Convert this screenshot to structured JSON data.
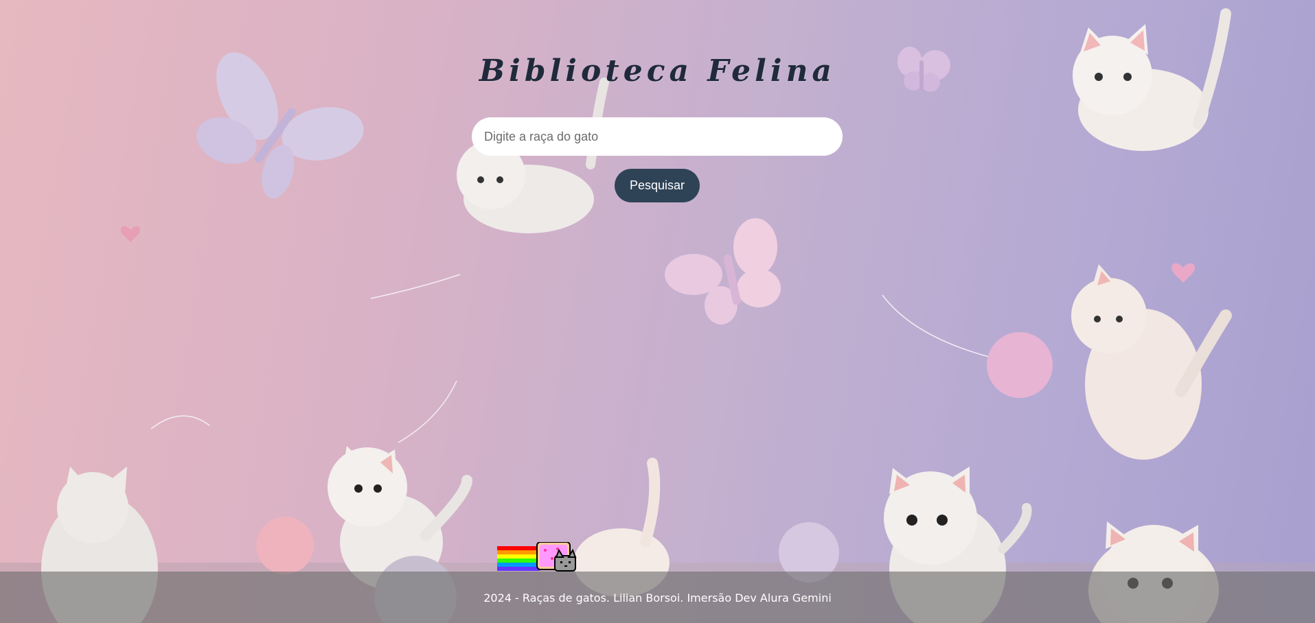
{
  "header": {
    "title": "Biblioteca Felina"
  },
  "search": {
    "placeholder": "Digite a raça do gato",
    "value": "",
    "button_label": "Pesquisar"
  },
  "footer": {
    "text": "2024 - Raças de gatos. Lilian Borsoi. Imersão Dev Alura Gemini"
  },
  "colors": {
    "title": "#1f2a3a",
    "button": "#2f4357",
    "footer_overlay": "#6e6e6e"
  },
  "icons": {
    "footer_gif": "nyan-cat-icon"
  }
}
